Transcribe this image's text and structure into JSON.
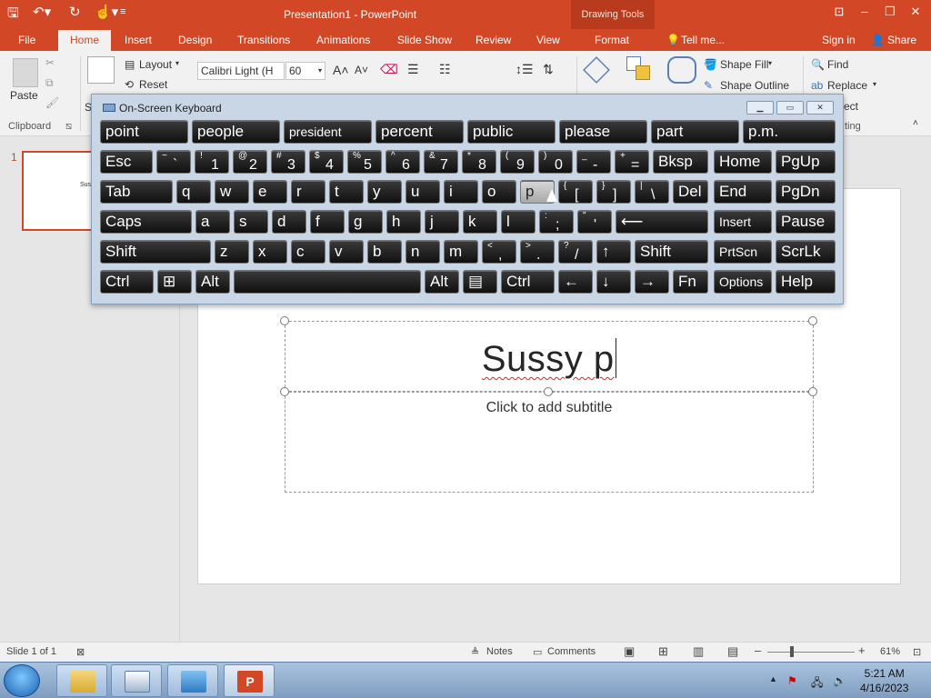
{
  "app": {
    "title": "Presentation1 - PowerPoint",
    "context_tab_group": "Drawing Tools",
    "sign_in": "Sign in",
    "share": "Share",
    "tell_me": "Tell me..."
  },
  "tabs": [
    "File",
    "Home",
    "Insert",
    "Design",
    "Transitions",
    "Animations",
    "Slide Show",
    "Review",
    "View",
    "Format"
  ],
  "ribbon": {
    "paste": "Paste",
    "layout": "Layout",
    "reset": "Reset",
    "section_initial": "S",
    "font_name": "Calibri Light (H",
    "font_size": "60",
    "shape_fill": "Shape Fill",
    "shape_outline": "Shape Outline",
    "find": "Find",
    "replace": "Replace",
    "select_partial": "ect",
    "clipboard_group": "Clipboard",
    "editing_partial": "ting"
  },
  "slides_pane": {
    "number": "1",
    "thumb_text": "Sus"
  },
  "slide": {
    "title_typed": "Sussy p",
    "subtitle_placeholder": "Click to add subtitle"
  },
  "osk": {
    "title": "On-Screen Keyboard",
    "prediction": [
      "point",
      "people",
      "president",
      "percent",
      "public",
      "please",
      "part",
      "p.m."
    ],
    "row1": [
      {
        "main": "Esc"
      },
      {
        "shift": "~",
        "main": "`"
      },
      {
        "shift": "!",
        "main": "1"
      },
      {
        "shift": "@",
        "main": "2"
      },
      {
        "shift": "#",
        "main": "3"
      },
      {
        "shift": "$",
        "main": "4"
      },
      {
        "shift": "%",
        "main": "5"
      },
      {
        "shift": "^",
        "main": "6"
      },
      {
        "shift": "&",
        "main": "7"
      },
      {
        "shift": "*",
        "main": "8"
      },
      {
        "shift": "(",
        "main": "9"
      },
      {
        "shift": ")",
        "main": "0"
      },
      {
        "shift": "_",
        "main": "-"
      },
      {
        "shift": "+",
        "main": "="
      },
      {
        "main": "Bksp"
      },
      {
        "main": "Home"
      },
      {
        "main": "PgUp"
      }
    ],
    "row2": [
      {
        "main": "Tab"
      },
      {
        "main": "q"
      },
      {
        "main": "w"
      },
      {
        "main": "e"
      },
      {
        "main": "r"
      },
      {
        "main": "t"
      },
      {
        "main": "y"
      },
      {
        "main": "u"
      },
      {
        "main": "i"
      },
      {
        "main": "o"
      },
      {
        "main": "p"
      },
      {
        "shift": "{",
        "main": "["
      },
      {
        "shift": "}",
        "main": "]"
      },
      {
        "shift": "|",
        "main": "\\"
      },
      {
        "main": "Del"
      },
      {
        "main": "End"
      },
      {
        "main": "PgDn"
      }
    ],
    "row3": [
      {
        "main": "Caps"
      },
      {
        "main": "a"
      },
      {
        "main": "s"
      },
      {
        "main": "d"
      },
      {
        "main": "f"
      },
      {
        "main": "g"
      },
      {
        "main": "h"
      },
      {
        "main": "j"
      },
      {
        "main": "k"
      },
      {
        "main": "l"
      },
      {
        "shift": ":",
        "main": ";"
      },
      {
        "shift": "\"",
        "main": "'"
      },
      {
        "main": "⟵"
      },
      {
        "main": "Insert"
      },
      {
        "main": "Pause"
      }
    ],
    "row4": [
      {
        "main": "Shift"
      },
      {
        "main": "z"
      },
      {
        "main": "x"
      },
      {
        "main": "c"
      },
      {
        "main": "v"
      },
      {
        "main": "b"
      },
      {
        "main": "n"
      },
      {
        "main": "m"
      },
      {
        "shift": "<",
        "main": ","
      },
      {
        "shift": ">",
        "main": "."
      },
      {
        "shift": "?",
        "main": "/"
      },
      {
        "main": "↑"
      },
      {
        "main": "Shift"
      },
      {
        "main": "PrtScn"
      },
      {
        "main": "ScrLk"
      }
    ],
    "row5": [
      {
        "main": "Ctrl"
      },
      {
        "main": "⊞"
      },
      {
        "main": "Alt"
      },
      {
        "main": ""
      },
      {
        "main": "Alt"
      },
      {
        "main": "▤"
      },
      {
        "main": "Ctrl"
      },
      {
        "main": "←"
      },
      {
        "main": "↓"
      },
      {
        "main": "→"
      },
      {
        "main": "Fn"
      },
      {
        "main": "Options"
      },
      {
        "main": "Help"
      }
    ]
  },
  "status": {
    "slide_of": "Slide 1 of 1",
    "notes": "Notes",
    "comments": "Comments",
    "zoom": "61%"
  },
  "taskbar": {
    "time": "5:21 AM",
    "date": "4/16/2023"
  },
  "colors": {
    "accent": "#d24726",
    "osk_key": "#1c1c1c",
    "osk_key_highlight": "#bdbdbd"
  }
}
